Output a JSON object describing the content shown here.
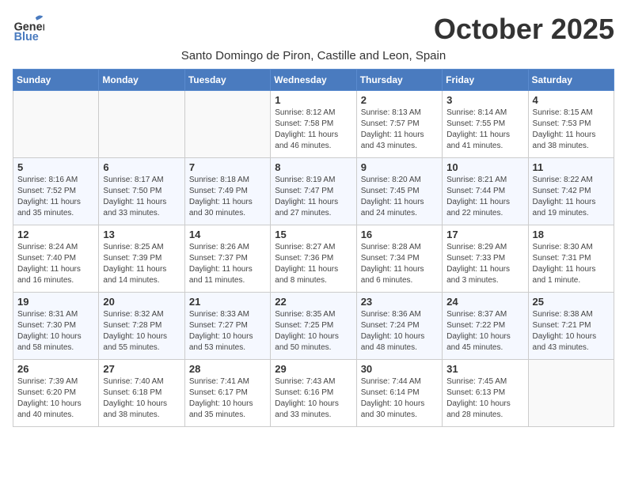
{
  "header": {
    "logo_general": "General",
    "logo_blue": "Blue",
    "month_title": "October 2025",
    "subtitle": "Santo Domingo de Piron, Castille and Leon, Spain"
  },
  "weekdays": [
    "Sunday",
    "Monday",
    "Tuesday",
    "Wednesday",
    "Thursday",
    "Friday",
    "Saturday"
  ],
  "weeks": [
    [
      {
        "day": "",
        "info": ""
      },
      {
        "day": "",
        "info": ""
      },
      {
        "day": "",
        "info": ""
      },
      {
        "day": "1",
        "info": "Sunrise: 8:12 AM\nSunset: 7:58 PM\nDaylight: 11 hours\nand 46 minutes."
      },
      {
        "day": "2",
        "info": "Sunrise: 8:13 AM\nSunset: 7:57 PM\nDaylight: 11 hours\nand 43 minutes."
      },
      {
        "day": "3",
        "info": "Sunrise: 8:14 AM\nSunset: 7:55 PM\nDaylight: 11 hours\nand 41 minutes."
      },
      {
        "day": "4",
        "info": "Sunrise: 8:15 AM\nSunset: 7:53 PM\nDaylight: 11 hours\nand 38 minutes."
      }
    ],
    [
      {
        "day": "5",
        "info": "Sunrise: 8:16 AM\nSunset: 7:52 PM\nDaylight: 11 hours\nand 35 minutes."
      },
      {
        "day": "6",
        "info": "Sunrise: 8:17 AM\nSunset: 7:50 PM\nDaylight: 11 hours\nand 33 minutes."
      },
      {
        "day": "7",
        "info": "Sunrise: 8:18 AM\nSunset: 7:49 PM\nDaylight: 11 hours\nand 30 minutes."
      },
      {
        "day": "8",
        "info": "Sunrise: 8:19 AM\nSunset: 7:47 PM\nDaylight: 11 hours\nand 27 minutes."
      },
      {
        "day": "9",
        "info": "Sunrise: 8:20 AM\nSunset: 7:45 PM\nDaylight: 11 hours\nand 24 minutes."
      },
      {
        "day": "10",
        "info": "Sunrise: 8:21 AM\nSunset: 7:44 PM\nDaylight: 11 hours\nand 22 minutes."
      },
      {
        "day": "11",
        "info": "Sunrise: 8:22 AM\nSunset: 7:42 PM\nDaylight: 11 hours\nand 19 minutes."
      }
    ],
    [
      {
        "day": "12",
        "info": "Sunrise: 8:24 AM\nSunset: 7:40 PM\nDaylight: 11 hours\nand 16 minutes."
      },
      {
        "day": "13",
        "info": "Sunrise: 8:25 AM\nSunset: 7:39 PM\nDaylight: 11 hours\nand 14 minutes."
      },
      {
        "day": "14",
        "info": "Sunrise: 8:26 AM\nSunset: 7:37 PM\nDaylight: 11 hours\nand 11 minutes."
      },
      {
        "day": "15",
        "info": "Sunrise: 8:27 AM\nSunset: 7:36 PM\nDaylight: 11 hours\nand 8 minutes."
      },
      {
        "day": "16",
        "info": "Sunrise: 8:28 AM\nSunset: 7:34 PM\nDaylight: 11 hours\nand 6 minutes."
      },
      {
        "day": "17",
        "info": "Sunrise: 8:29 AM\nSunset: 7:33 PM\nDaylight: 11 hours\nand 3 minutes."
      },
      {
        "day": "18",
        "info": "Sunrise: 8:30 AM\nSunset: 7:31 PM\nDaylight: 11 hours\nand 1 minute."
      }
    ],
    [
      {
        "day": "19",
        "info": "Sunrise: 8:31 AM\nSunset: 7:30 PM\nDaylight: 10 hours\nand 58 minutes."
      },
      {
        "day": "20",
        "info": "Sunrise: 8:32 AM\nSunset: 7:28 PM\nDaylight: 10 hours\nand 55 minutes."
      },
      {
        "day": "21",
        "info": "Sunrise: 8:33 AM\nSunset: 7:27 PM\nDaylight: 10 hours\nand 53 minutes."
      },
      {
        "day": "22",
        "info": "Sunrise: 8:35 AM\nSunset: 7:25 PM\nDaylight: 10 hours\nand 50 minutes."
      },
      {
        "day": "23",
        "info": "Sunrise: 8:36 AM\nSunset: 7:24 PM\nDaylight: 10 hours\nand 48 minutes."
      },
      {
        "day": "24",
        "info": "Sunrise: 8:37 AM\nSunset: 7:22 PM\nDaylight: 10 hours\nand 45 minutes."
      },
      {
        "day": "25",
        "info": "Sunrise: 8:38 AM\nSunset: 7:21 PM\nDaylight: 10 hours\nand 43 minutes."
      }
    ],
    [
      {
        "day": "26",
        "info": "Sunrise: 7:39 AM\nSunset: 6:20 PM\nDaylight: 10 hours\nand 40 minutes."
      },
      {
        "day": "27",
        "info": "Sunrise: 7:40 AM\nSunset: 6:18 PM\nDaylight: 10 hours\nand 38 minutes."
      },
      {
        "day": "28",
        "info": "Sunrise: 7:41 AM\nSunset: 6:17 PM\nDaylight: 10 hours\nand 35 minutes."
      },
      {
        "day": "29",
        "info": "Sunrise: 7:43 AM\nSunset: 6:16 PM\nDaylight: 10 hours\nand 33 minutes."
      },
      {
        "day": "30",
        "info": "Sunrise: 7:44 AM\nSunset: 6:14 PM\nDaylight: 10 hours\nand 30 minutes."
      },
      {
        "day": "31",
        "info": "Sunrise: 7:45 AM\nSunset: 6:13 PM\nDaylight: 10 hours\nand 28 minutes."
      },
      {
        "day": "",
        "info": ""
      }
    ]
  ]
}
